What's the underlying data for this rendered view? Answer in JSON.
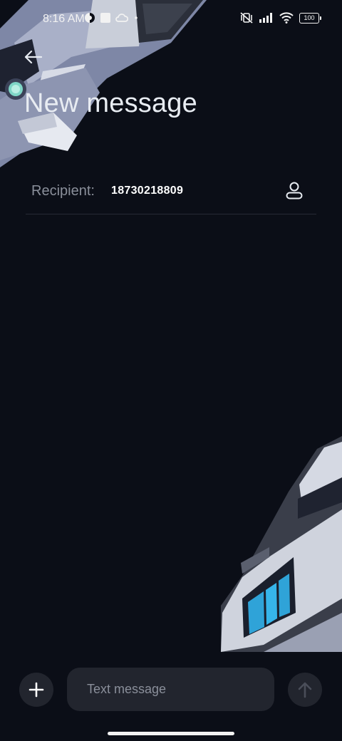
{
  "status_bar": {
    "time": "8:16 AM",
    "battery": "100",
    "left_icons": [
      "data-saver-icon",
      "app-notification-icon",
      "cloud-icon",
      "dot-icon"
    ],
    "right_icons": [
      "vibrate-off-icon",
      "signal-icon",
      "wifi-icon",
      "battery-icon"
    ]
  },
  "header": {
    "title": "New message",
    "back_icon": "arrow-left-icon"
  },
  "recipient": {
    "label": "Recipient:",
    "value": "18730218809",
    "contact_icon": "person-icon"
  },
  "compose": {
    "placeholder": "Text message",
    "add_icon": "plus-icon",
    "send_icon": "arrow-up-icon"
  },
  "colors": {
    "background": "#0b0e17",
    "surface": "#22252e",
    "divider": "#262a35",
    "muted_text": "#8a8f9a",
    "text": "#ffffff"
  }
}
